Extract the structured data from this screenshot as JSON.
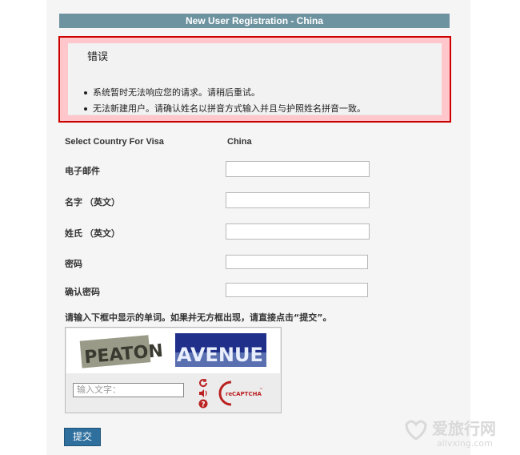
{
  "form": {
    "title": "New User Registration - China"
  },
  "error": {
    "title": "错误",
    "items": [
      "系统暂时无法响应您的请求。请稍后重试。",
      "无法新建用户。请确认姓名以拼音方式输入并且与护照姓名拼音一致。"
    ]
  },
  "fields": {
    "country_label": "Select Country For Visa",
    "country_value": "China",
    "email_label": "电子邮件",
    "first_name_label": "名字 （英文）",
    "last_name_label": "姓氏 （英文）",
    "password_label": "密码",
    "confirm_password_label": "确认密码"
  },
  "captcha": {
    "prompt": "请输入下框中显示的单词。如果并无方框出现，请直接点击“提交”。",
    "word1": "PEATON",
    "word2": "AVENUE",
    "input_placeholder": "输入文字：",
    "refresh_icon": "refresh-icon",
    "audio_icon": "audio-icon",
    "help_icon": "help-icon",
    "logo_text_re": "re",
    "logo_text": "CAPTCHA",
    "logo_tm": "™"
  },
  "submit_label": "提交",
  "watermark": {
    "brand": "爱旅行网",
    "domain": "ailvxing.com"
  },
  "colors": {
    "title_bar": "#6e93a0",
    "error_border": "#cc0000",
    "error_bg": "#ffc7cc",
    "submit": "#2e6f9e"
  }
}
